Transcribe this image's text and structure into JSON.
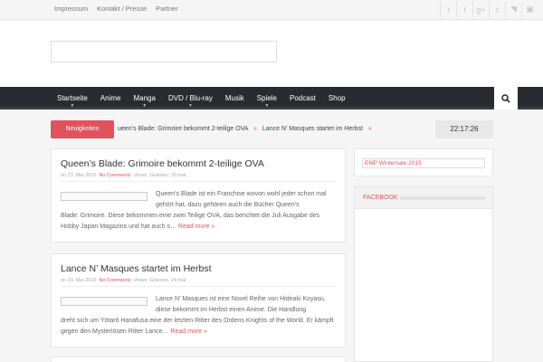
{
  "toplinks": [
    "Impressum",
    "Kontakt / Presse",
    "Partner"
  ],
  "social_icons": [
    "twitter-icon",
    "facebook-icon",
    "google-plus-icon",
    "tumblr-icon",
    "rss-icon",
    "image-icon"
  ],
  "social_glyphs": [
    "t",
    "f",
    "g+",
    "t",
    "◥",
    "▣"
  ],
  "nav": [
    "Startseite",
    "Anime",
    "Manga",
    "DVD / Blu-ray",
    "Musik",
    "Spiele",
    "Podcast",
    "Shop"
  ],
  "nav_dropdown": [
    true,
    false,
    true,
    true,
    false,
    true,
    false,
    false
  ],
  "ticker": {
    "label": "Neuigkeiten",
    "item1": "ueen’s Blade: Grimoire bekommt 2-teilige OVA",
    "item2": "Lance N’ Masques startet im Herbst",
    "clock": "22:17:26"
  },
  "posts": [
    {
      "title": "Queen’s Blade: Grimoire bekommt 2-teilige OVA",
      "date": "on 23. Mai 2015",
      "comments": "No Comments",
      "views": "Views: Gelesen: 20 mal",
      "excerpt": "Queen’s Blade ist ein Franchise wovon wohl jeder schon mal gehört hat, dazu gehören auch die Bücher Queen’s",
      "excerpt2": "Blade: Grimoire. Diese bekommen eine zwei Teilige OVA, das berichtet die Juli Ausgabe des Hobby Japan Magazins und hat auch s…",
      "more": "Read more »"
    },
    {
      "title": "Lance N’ Masques startet im Herbst",
      "date": "on 23. Mai 2015",
      "comments": "No Comments",
      "views": "Views: Gelesen: 24 mal",
      "excerpt": "Lance N’ Masques ist eine Novel Reihe von Hideaki Koyasu, diese bekommt im Herbst einen Anime. Die Handlung",
      "excerpt2": "dreht sich um Yōtarō Hanafusa eine der letzten Ritter des Ordens Knights of the World. Er kämpft gegen den Mysteriösen Ritter Lance…",
      "more": "Read more »"
    }
  ],
  "sidebar": {
    "widget1": "EMP Wintersale 2015",
    "widget2_title": "FACEBOOK"
  }
}
